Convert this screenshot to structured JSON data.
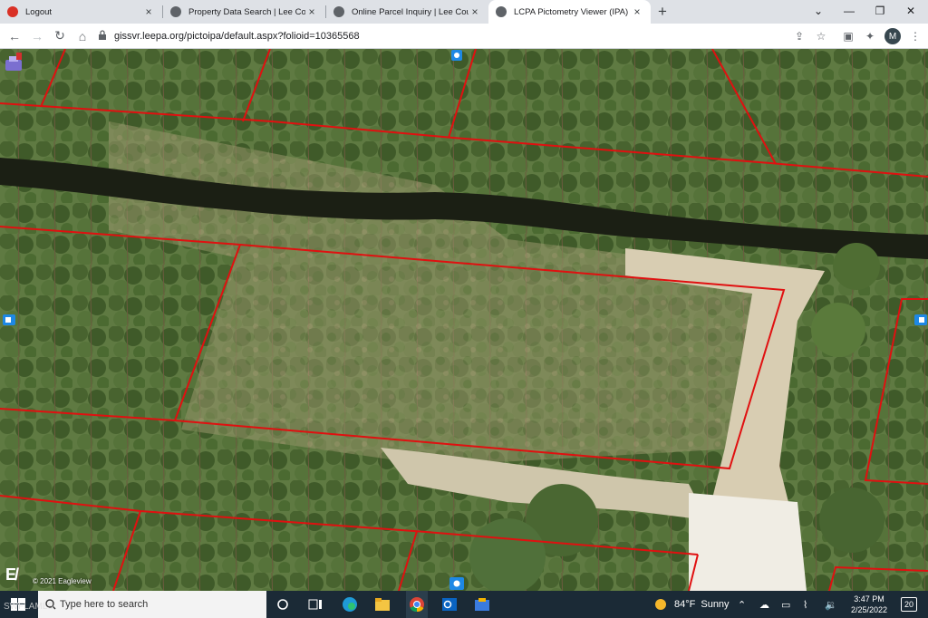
{
  "browser": {
    "tabs": [
      {
        "title": "Logout",
        "favicon": "lee-county-favicon",
        "color": "#d93025"
      },
      {
        "title": "Property Data Search | Lee Count",
        "favicon": "globe-icon",
        "color": "#5f6368"
      },
      {
        "title": "Online Parcel Inquiry | Lee Count",
        "favicon": "globe-icon",
        "color": "#5f6368"
      },
      {
        "title": "LCPA Pictometry Viewer (IPA)",
        "favicon": "globe-icon",
        "color": "#5f6368"
      }
    ],
    "active_tab": 3,
    "close_glyph": "×",
    "new_tab_glyph": "+",
    "url": "gissvr.leepa.org/pictoipa/default.aspx?folioid=10365568",
    "profile_initial": "M"
  },
  "map": {
    "copyright": "© 2021 Eagleview",
    "logo_text": "EV"
  },
  "taskbar": {
    "search_placeholder": "Type here to search",
    "weather_temp": "84°F",
    "weather_desc": "Sunny",
    "time": "3:47 PM",
    "date": "2/25/2022",
    "notifications": "20"
  },
  "watermark": "SWFLAMLS",
  "colors": {
    "parcel_line": "#e01010",
    "taskbar_bg": "#1b2a36",
    "tab_strip_bg": "#dee1e6"
  }
}
